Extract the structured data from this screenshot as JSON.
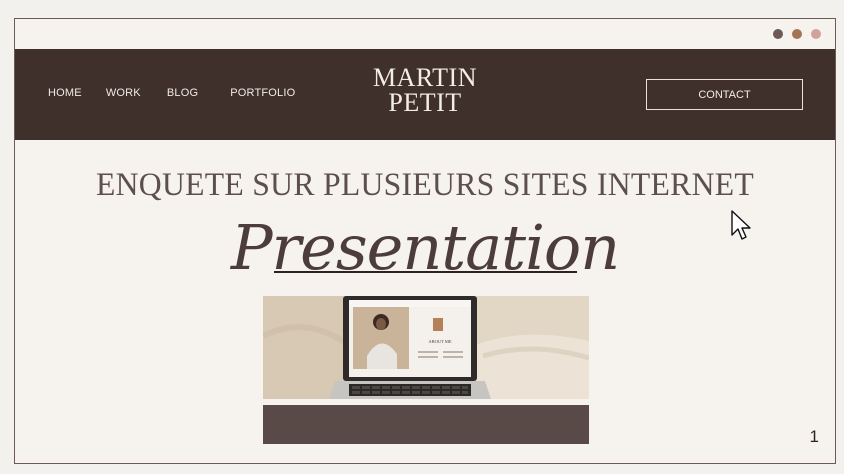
{
  "colors": {
    "background": "#f6f3ef",
    "navbar": "#3f302c",
    "accent_block": "#5a4a47",
    "dot_1": "#6d5a54",
    "dot_2": "#a47455",
    "dot_3": "#cfa39a"
  },
  "window_controls": {
    "dots": [
      "dot-1",
      "dot-2",
      "dot-3"
    ]
  },
  "navbar": {
    "links": [
      "HOME",
      "WORK",
      "BLOG",
      "PORTFOLIO"
    ],
    "brand_line1": "MARTIN",
    "brand_line2": "PETIT",
    "contact_label": "CONTACT"
  },
  "content": {
    "headline": "ENQUETE SUR PLUSIEURS SITES INTERNET",
    "script_title": "Presentation",
    "image_caption": "ABOUT ME"
  },
  "footer": {
    "page_number": "1"
  },
  "icons": {
    "cursor": "mouse-pointer-icon"
  }
}
